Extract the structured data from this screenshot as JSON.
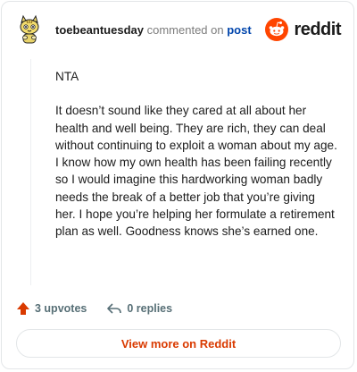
{
  "comment": {
    "username": "toebeantuesday",
    "action_text": "commented on",
    "post_link": "post",
    "paragraphs": [
      "NTA",
      "It doesn’t sound like they cared at all about her health and well being. They are rich, they can deal without continuing to exploit a woman about my age. I know how my own health has been failing recently so I would imagine this hardworking woman badly needs the break of a better job that you’re giving her. I hope you’re helping her formulate a retirement plan as well. Goodness knows she’s earned one."
    ]
  },
  "brand": {
    "name": "reddit",
    "color": "#ff4500"
  },
  "actions": {
    "upvotes": "3 upvotes",
    "replies": "0 replies"
  },
  "footer": {
    "button_label": "View more on Reddit"
  },
  "icons": {
    "avatar": "snoo-avatar-icon",
    "logo": "reddit-logo-icon",
    "upvote": "upvote-arrow-icon",
    "reply": "reply-arrow-icon"
  }
}
